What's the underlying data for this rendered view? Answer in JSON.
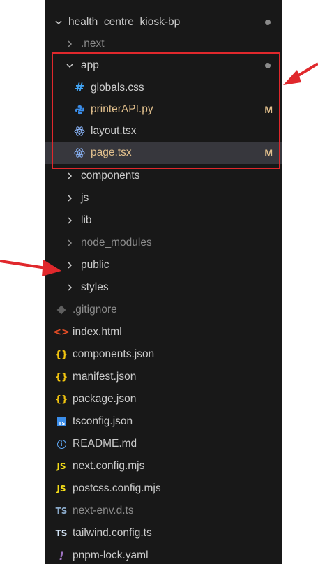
{
  "explorer": {
    "root": {
      "label": "health_centre_kiosk-bp"
    },
    "items": [
      {
        "label": ".next",
        "kind": "folder",
        "dim": true
      },
      {
        "label": "app",
        "kind": "folder-open"
      },
      {
        "label": "globals.css",
        "kind": "file",
        "icon": "hash-icon"
      },
      {
        "label": "printerAPI.py",
        "kind": "file",
        "icon": "python-icon",
        "badge": "M"
      },
      {
        "label": "layout.tsx",
        "kind": "file",
        "icon": "react-icon"
      },
      {
        "label": "page.tsx",
        "kind": "file",
        "icon": "react-icon",
        "badge": "M",
        "selected": true
      },
      {
        "label": "components",
        "kind": "folder"
      },
      {
        "label": "js",
        "kind": "folder"
      },
      {
        "label": "lib",
        "kind": "folder"
      },
      {
        "label": "node_modules",
        "kind": "folder",
        "dim": true
      },
      {
        "label": "public",
        "kind": "folder"
      },
      {
        "label": "styles",
        "kind": "folder"
      },
      {
        "label": ".gitignore",
        "kind": "file",
        "icon": "git-icon",
        "dim": true
      },
      {
        "label": "index.html",
        "kind": "file",
        "icon": "html-icon"
      },
      {
        "label": "components.json",
        "kind": "file",
        "icon": "json-icon"
      },
      {
        "label": "manifest.json",
        "kind": "file",
        "icon": "json-icon"
      },
      {
        "label": "package.json",
        "kind": "file",
        "icon": "json-icon"
      },
      {
        "label": "tsconfig.json",
        "kind": "file",
        "icon": "tsconfig-icon"
      },
      {
        "label": "README.md",
        "kind": "file",
        "icon": "info-icon"
      },
      {
        "label": "next.config.mjs",
        "kind": "file",
        "icon": "js-icon"
      },
      {
        "label": "postcss.config.mjs",
        "kind": "file",
        "icon": "js-icon"
      },
      {
        "label": "next-env.d.ts",
        "kind": "file",
        "icon": "ts-icon",
        "dim": true
      },
      {
        "label": "tailwind.config.ts",
        "kind": "file",
        "icon": "ts-icon"
      },
      {
        "label": "pnpm-lock.yaml",
        "kind": "file",
        "icon": "yaml-icon"
      }
    ]
  },
  "icon_glyphs": {
    "hash": "#",
    "braces": "{}",
    "ts_square": "TS",
    "info": "i",
    "js": "JS",
    "ts": "TS",
    "exclaim": "!",
    "html": "<>"
  },
  "colors": {
    "panel_bg": "#181818",
    "selected_bg": "#37373d",
    "modified": "#e2c08d",
    "annotation": "#e0282c"
  }
}
